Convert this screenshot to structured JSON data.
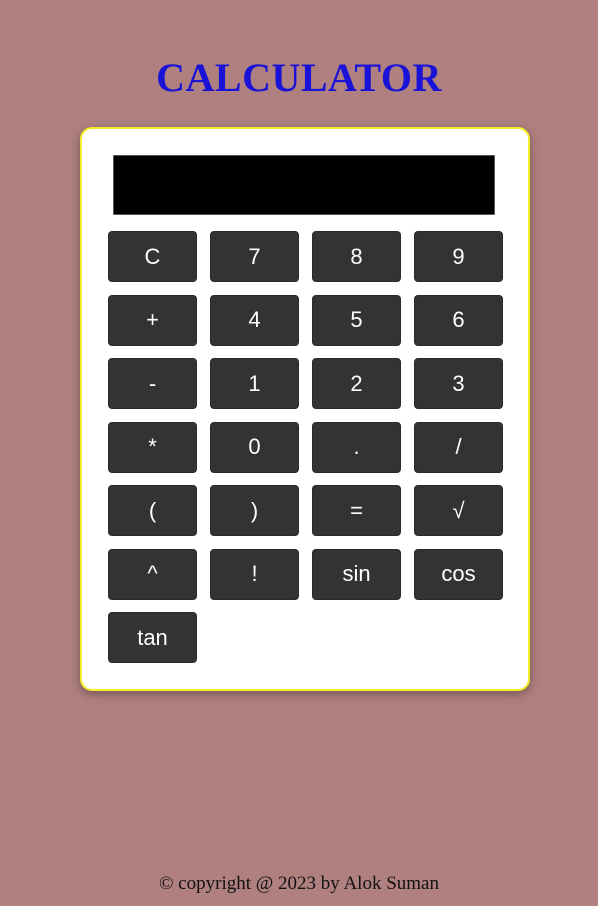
{
  "header": {
    "title": "CALCULATOR"
  },
  "calculator": {
    "display_value": "",
    "keys": [
      "C",
      "7",
      "8",
      "9",
      "+",
      "4",
      "5",
      "6",
      "-",
      "1",
      "2",
      "3",
      "*",
      "0",
      ".",
      "/",
      "(",
      ")",
      "=",
      "√",
      "^",
      "!",
      "sin",
      "cos",
      "tan"
    ]
  },
  "footer": {
    "text": "© copyright @ 2023 by Alok Suman"
  },
  "colors": {
    "background": "#b08080",
    "title": "#1a12d6",
    "panel": "#ffffff",
    "panel_border": "#f2ee2a",
    "display": "#000000",
    "key": "#333333",
    "key_text": "#ffffff"
  }
}
